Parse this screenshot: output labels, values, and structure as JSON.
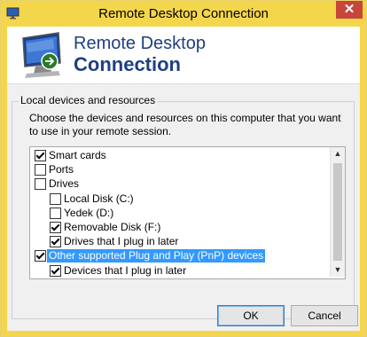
{
  "window": {
    "title": "Remote Desktop Connection",
    "close_label": "✕"
  },
  "banner": {
    "title_line1": "Remote Desktop",
    "title_line2": "Connection"
  },
  "group": {
    "title": "Local devices and resources",
    "description": "Choose the devices and resources on this computer that you want to use in your remote session."
  },
  "tree": {
    "items": [
      {
        "label": "Smart cards",
        "checked": true,
        "expander": "",
        "selected": false
      },
      {
        "label": "Ports",
        "checked": false,
        "expander": "",
        "selected": false
      },
      {
        "label": "Drives",
        "checked": false,
        "expander": "−",
        "selected": false
      },
      {
        "label": "Local Disk (C:)",
        "checked": false,
        "expander": "",
        "selected": false
      },
      {
        "label": "Yedek (D:)",
        "checked": false,
        "expander": "",
        "selected": false
      },
      {
        "label": "Removable Disk (F:)",
        "checked": true,
        "expander": "",
        "selected": false
      },
      {
        "label": "Drives that I plug in later",
        "checked": true,
        "expander": "",
        "selected": false
      },
      {
        "label": "Other supported Plug and Play (PnP) devices",
        "checked": true,
        "expander": "−",
        "selected": true
      },
      {
        "label": "Devices that I plug in later",
        "checked": true,
        "expander": "",
        "selected": false
      }
    ],
    "scroll_up": "▲",
    "scroll_down": "▼"
  },
  "buttons": {
    "ok": "OK",
    "cancel": "Cancel"
  },
  "colors": {
    "title_bar": "#f4d64c",
    "close_button": "#c7463a",
    "banner_text": "#1f3f82",
    "selection": "#3399ff"
  }
}
